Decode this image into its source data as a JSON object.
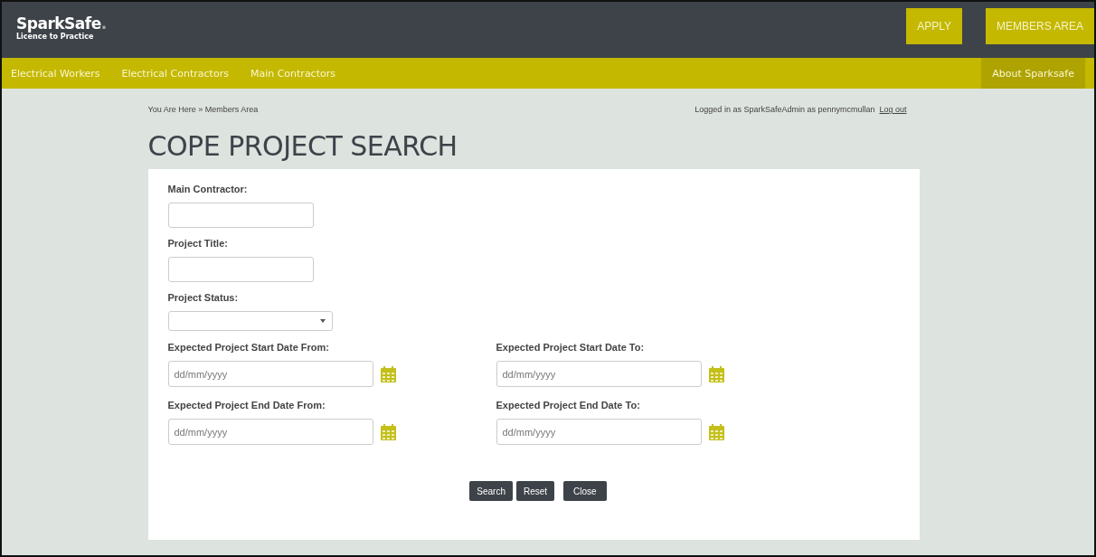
{
  "header": {
    "logo": "SparkSafe",
    "logo_dot": ".",
    "tagline": "Licence to Practice",
    "buttons": [
      {
        "label": "APPLY"
      },
      {
        "label": "MEMBERS AREA"
      }
    ]
  },
  "nav": {
    "items": [
      {
        "label": "Electrical Workers",
        "selected": false
      },
      {
        "label": "Electrical Contractors",
        "selected": false
      },
      {
        "label": "Main Contractors",
        "selected": false
      }
    ],
    "right_item": {
      "label": "About Sparksafe",
      "selected": true
    }
  },
  "breadcrumb": "You Are Here » Members Area",
  "login": {
    "text": "Logged in as SparkSafeAdmin as pennymcmullan",
    "link": "Log out"
  },
  "title": "COPE PROJECT SEARCH",
  "form": {
    "fields": [
      {
        "kind": "text",
        "label": "Main Contractor:"
      },
      {
        "kind": "text",
        "label": "Project Title:"
      },
      {
        "kind": "select",
        "label": "Project Status:"
      }
    ],
    "date_rows": [
      [
        {
          "label": "Expected Project Start Date From:",
          "placeholder": "dd/mm/yyyy"
        },
        {
          "label": "Expected Project Start Date To:",
          "placeholder": "dd/mm/yyyy"
        }
      ],
      [
        {
          "label": "Expected Project End Date From:",
          "placeholder": "dd/mm/yyyy"
        },
        {
          "label": "Expected Project End Date To:",
          "placeholder": "dd/mm/yyyy"
        }
      ]
    ],
    "buttons": [
      "Search",
      "Reset",
      "Close"
    ]
  }
}
